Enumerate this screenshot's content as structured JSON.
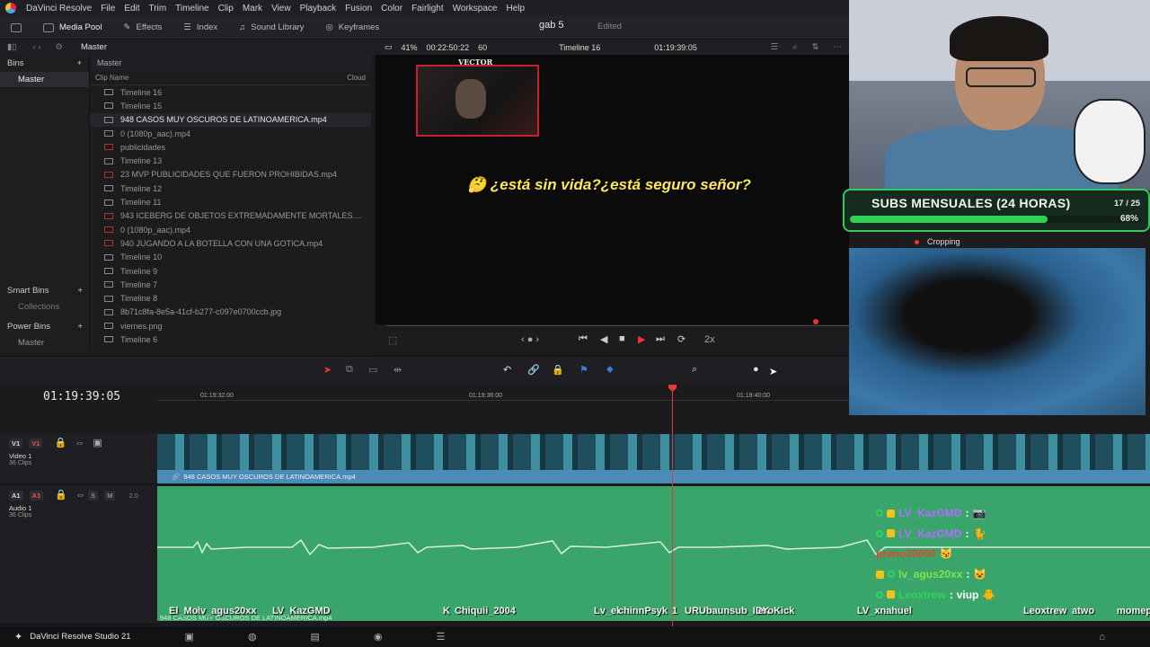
{
  "menubar": {
    "items": [
      "DaVinci Resolve",
      "File",
      "Edit",
      "Trim",
      "Timeline",
      "Clip",
      "Mark",
      "View",
      "Playback",
      "Fusion",
      "Color",
      "Fairlight",
      "Workspace",
      "Help"
    ]
  },
  "toolbar": {
    "media_pool": "Media Pool",
    "effects": "Effects",
    "index": "Index",
    "sound_library": "Sound Library",
    "keyframes": "Keyframes"
  },
  "project": {
    "name": "gab 5",
    "status": "Edited"
  },
  "subbar": {
    "master": "Master"
  },
  "viewer_bar": {
    "zoom": "41%",
    "duration": "00:22:50:22",
    "fps": "60",
    "timeline_name": "Timeline 16",
    "timecode": "01:19:39:05"
  },
  "bins": {
    "header": "Bins",
    "master": "Master",
    "smart_bins": "Smart Bins",
    "collections": "Collections",
    "power_bins": "Power Bins",
    "power_master": "Master"
  },
  "clips": {
    "path": "Master",
    "col_name": "Clip Name",
    "col_cloud": "Cloud",
    "items": [
      "Timeline 16",
      "Timeline 15",
      "948 CASOS MUY OSCUROS DE LATINOAMERICA.mp4",
      "0 (1080p_aac).mp4",
      "publicidades",
      "Timeline 13",
      "23 MVP PUBLICIDADES QUE FUERON PROHIBIDAS.mp4",
      "Timeline 12",
      "Timeline 11",
      "943 ICEBERG DE OBJETOS EXTREMADAMENTE MORTALES....",
      "0 (1080p_aac).mp4",
      "940 JUGANDO A LA BOTELLA CON UNA GOTICA.mp4",
      "Timeline 10",
      "Timeline 9",
      "Timeline 7",
      "Timeline 8",
      "8b71c8fa-8e5a-41cf-b277-c097e0700ccb.jpg",
      "viernes.png",
      "Timeline 6"
    ]
  },
  "viewer": {
    "thumb_caption": "VECTOR",
    "subtitle": "¿está sin vida?¿está seguro señor?",
    "speed": "2x"
  },
  "timeline": {
    "timecode": "01:19:39:05",
    "ruler": [
      "01:19:32:00",
      "01:19:36:00",
      "01:19:40:00"
    ],
    "v1": {
      "tag1": "V1",
      "tag2": "V1",
      "name": "Video 1",
      "clips": "36 Clips",
      "clip_label": "948 CASOS MUY OSCUROS DE LATINOAMERICA.mp4"
    },
    "a1": {
      "tag1": "A1",
      "tag2": "A1",
      "name": "Audio 1",
      "clips": "36 Clips",
      "gain": "2.0",
      "s": "S",
      "m": "M",
      "clip_label": "948 CASOS MUY OSCUROS DE LATINOAMERICA.mp4"
    }
  },
  "taskbar": {
    "app": "DaVinci Resolve Studio 21"
  },
  "overlay": {
    "subs_title": "SUBS MENSUALES (24 HORAS)",
    "subs_count": "17 / 25",
    "subs_pct": "68%",
    "subs_progress": 0.68,
    "cropping": "Cropping",
    "chat": [
      {
        "user": "LV_KazGMD",
        "msg": "",
        "color": "#b36cff"
      },
      {
        "user": "LV_KazGMD",
        "msg": "",
        "color": "#b36cff"
      },
      {
        "user": "prano20000",
        "msg": "",
        "color": "#e0462f"
      },
      {
        "user": "lv_agus20xx",
        "msg": "",
        "color": "#7ee64a"
      },
      {
        "user": "Leoxtrew",
        "msg": "viup",
        "color": "#2fd35c"
      }
    ],
    "names": [
      "El_Mo",
      "lv_agus20xx",
      "LV_KazGMD",
      "K",
      "Chiquii_2004",
      "Lv_el",
      "chinnPsyk",
      "1",
      "URUbaunsub_IDK",
      "eroKick",
      "LV_xnahuel",
      "Leoxtrew",
      "atwo",
      "momep"
    ]
  }
}
